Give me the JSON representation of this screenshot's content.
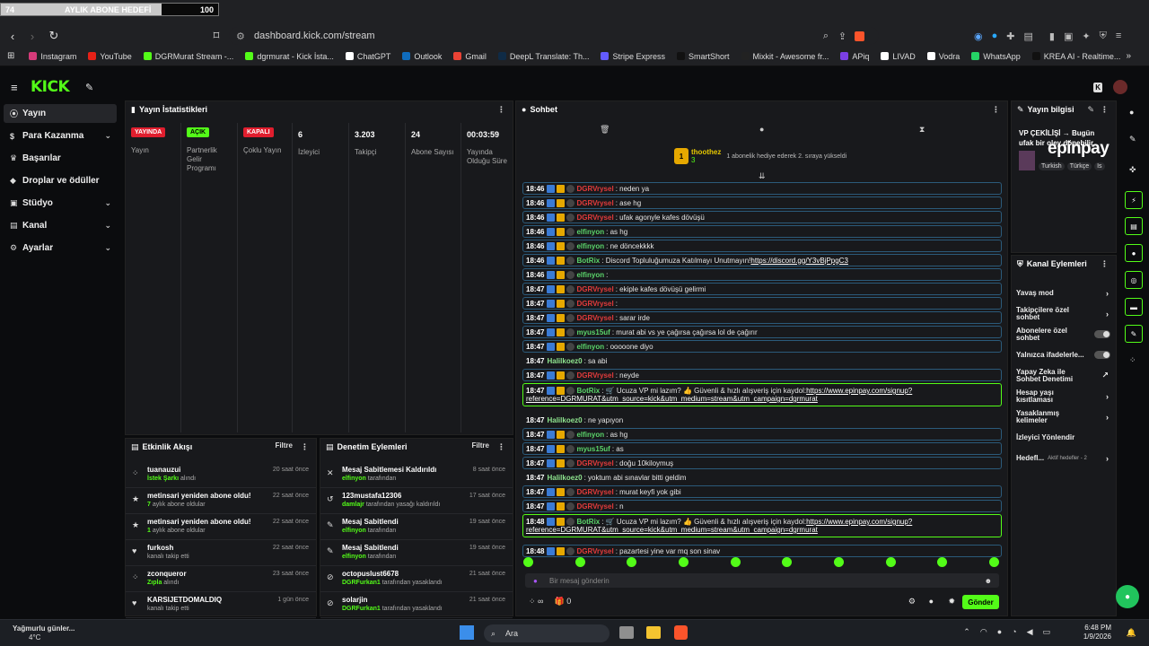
{
  "goal": {
    "current": "74",
    "label": "AYLIK ABONE HEDEFİ",
    "target": "100",
    "progress": 0.74
  },
  "browser": {
    "url": "dashboard.kick.com/stream",
    "bookmarks": [
      {
        "label": "Instagram",
        "color": "#d63b7a"
      },
      {
        "label": "YouTube",
        "color": "#e62117"
      },
      {
        "label": "DGRMurat Stream -...",
        "color": "#53fc18"
      },
      {
        "label": "dgrmurat - Kick İsta...",
        "color": "#53fc18"
      },
      {
        "label": "ChatGPT",
        "color": "#ffffff"
      },
      {
        "label": "Outlook",
        "color": "#0f6cbd"
      },
      {
        "label": "Gmail",
        "color": "#ea4335"
      },
      {
        "label": "DeepL Translate: Th...",
        "color": "#0f2b46"
      },
      {
        "label": "Stripe Express",
        "color": "#635bff"
      },
      {
        "label": "SmartShort",
        "color": "#111111"
      },
      {
        "label": "Mixkit - Awesome fr...",
        "color": "#222222"
      },
      {
        "label": "APiq",
        "color": "#7b3fe4"
      },
      {
        "label": "LIVAD",
        "color": "#ffffff"
      },
      {
        "label": "Vodra",
        "color": "#ffffff"
      },
      {
        "label": "WhatsApp",
        "color": "#25d366"
      },
      {
        "label": "KREA AI - Realtime...",
        "color": "#111111"
      }
    ]
  },
  "sidebar": {
    "items": [
      {
        "label": "Yayın",
        "icon": "broadcast-icon"
      },
      {
        "label": "Para Kazanma",
        "icon": "dollar-icon"
      },
      {
        "label": "Başarılar",
        "icon": "trophy-icon"
      },
      {
        "label": "Droplar ve ödüller",
        "icon": "gift-icon"
      },
      {
        "label": "Stüdyo",
        "icon": "studio-icon"
      },
      {
        "label": "Kanal",
        "icon": "channel-icon"
      },
      {
        "label": "Ayarlar",
        "icon": "gear-icon"
      }
    ]
  },
  "stats": {
    "title": "Yayın İstatistikleri",
    "columns": [
      {
        "badge": "YAYINDA",
        "label": "Yayın"
      },
      {
        "badge": "AÇIK",
        "label": "Partnerlik Gelir Programı"
      },
      {
        "badge": "KAPALI",
        "label": "Çoklu Yayın"
      },
      {
        "value": "6",
        "label": "İzleyici"
      },
      {
        "value": "3.203",
        "label": "Takipçi"
      },
      {
        "value": "24",
        "label": "Abone Sayısı"
      },
      {
        "value": "00:03:59",
        "label": "Yayında Olduğu Süre"
      }
    ]
  },
  "activity": {
    "title": "Etkinlik Akışı",
    "filter": "Filtre",
    "rows": [
      {
        "t1": "tuanauzui",
        "t2b": "İstek Şarkı",
        "t2": " alındı",
        "time": "20 saat önce"
      },
      {
        "t1": "metinsari yeniden abone oldu!",
        "t2b": "7",
        "t2": " aylık abone oldular",
        "time": "22 saat önce"
      },
      {
        "t1": "metinsari yeniden abone oldu!",
        "t2b": "1",
        "t2": " aylık abone oldular",
        "time": "22 saat önce"
      },
      {
        "t1": "furkosh",
        "t2b": "",
        "t2": "kanalı takip etti",
        "time": "22 saat önce"
      },
      {
        "t1": "zconqueror",
        "t2b": "Zıpla",
        "t2": " alındı",
        "time": "23 saat önce"
      },
      {
        "t1": "KARSIJETDOMALDIQ",
        "t2b": "",
        "t2": "kanalı takip etti",
        "time": "1 gün önce"
      }
    ]
  },
  "moderation": {
    "title": "Denetim Eylemleri",
    "filter": "Filtre",
    "rows": [
      {
        "t1": "Mesaj Sabitlemesi Kaldırıldı",
        "t2b": "elfinyon",
        "t2": " tarafından",
        "time": "8 saat önce"
      },
      {
        "t1": "123mustafa12306",
        "t2b": "damlajr",
        "t2": " tarafından yasağı kaldırıldı",
        "time": "17 saat önce"
      },
      {
        "t1": "Mesaj Sabitlendi",
        "t2b": "elfinyon",
        "t2": " tarafından",
        "time": "19 saat önce"
      },
      {
        "t1": "Mesaj Sabitlendi",
        "t2b": "elfinyon",
        "t2": " tarafından",
        "time": "19 saat önce"
      },
      {
        "t1": "octopuslust6678",
        "t2b": "DGRFurkan1",
        "t2": " tarafından yasaklandı",
        "time": "21 saat önce"
      },
      {
        "t1": "solarjin",
        "t2b": "DGRFurkan1",
        "t2": " tarafından yasaklandı",
        "time": "21 saat önce"
      }
    ]
  },
  "chat": {
    "title": "Sohbet",
    "pinned_user": "thoothez",
    "pinned_count": "3",
    "pinned_text": "1 abonelik hediye ederek 2. sıraya yükseldi",
    "messages": [
      {
        "time": "18:46",
        "user": "DGRVrysel",
        "color": "red",
        "text": ": neden ya"
      },
      {
        "time": "18:46",
        "user": "DGRVrysel",
        "color": "red",
        "text": ": ase hg"
      },
      {
        "time": "18:46",
        "user": "DGRVrysel",
        "color": "red",
        "text": ": ufak agonyle kafes dövüşü"
      },
      {
        "time": "18:46",
        "user": "elfinyon",
        "color": "grn",
        "text": ": as hg"
      },
      {
        "time": "18:46",
        "user": "elfinyon",
        "color": "grn",
        "text": ": ne döncekkkk"
      },
      {
        "time": "18:46",
        "user": "BotRix",
        "color": "grn",
        "text": ": Discord Topluluğumuza Katılmayı Unutmayın! ",
        "link": "https://discord.gg/Y3vBjPpgC3"
      },
      {
        "time": "18:46",
        "user": "elfinyon",
        "color": "grn",
        "text": ":"
      },
      {
        "time": "18:47",
        "user": "DGRVrysel",
        "color": "red",
        "text": ": ekiple kafes dövüşü gelirmi"
      },
      {
        "time": "18:47",
        "user": "DGRVrysel",
        "color": "red",
        "text": ":"
      },
      {
        "time": "18:47",
        "user": "DGRVrysel",
        "color": "red",
        "text": ": sarar irde"
      },
      {
        "time": "18:47",
        "user": "myus15uf",
        "color": "grn",
        "text": ": murat abi vs ye çağırsa çağırsa lol de çağırır"
      },
      {
        "time": "18:47",
        "user": "elfinyon",
        "color": "grn",
        "text": ": ooooone diyo"
      },
      {
        "time": "18:47",
        "user": "Halilkoez0",
        "color": "lgr",
        "text": ": sa abi"
      },
      {
        "time": "18:47",
        "user": "DGRVrysel",
        "color": "red",
        "text": ": neyde"
      },
      {
        "time": "18:47",
        "user": "BotRix",
        "color": "grn",
        "text": ": 🛒 Ucuza VP mi lazım? 👍 Güvenli & hızlı alışveriş için kaydol: ",
        "link": "https://www.epinpay.com/signup?",
        "line2": "reference=DGRMURAT&utm_source=kick&utm_medium=stream&utm_campaign=dgrmurat"
      },
      {
        "time": "18:47",
        "user": "Halilkoez0",
        "color": "lgr",
        "text": ": ne yapıyon"
      },
      {
        "time": "18:47",
        "user": "elfinyon",
        "color": "grn",
        "text": ": as hg"
      },
      {
        "time": "18:47",
        "user": "myus15uf",
        "color": "grn",
        "text": ": as"
      },
      {
        "time": "18:47",
        "user": "DGRVrysel",
        "color": "red",
        "text": ": doğu 10kiloymuş"
      },
      {
        "time": "18:47",
        "user": "Halilkoez0",
        "color": "lgr",
        "text": ": yoktum abi sınavlar bitti geldim"
      },
      {
        "time": "18:47",
        "user": "DGRVrysel",
        "color": "red",
        "text": ": murat keyfi yok gibi"
      },
      {
        "time": "18:47",
        "user": "DGRVrysel",
        "color": "red",
        "text": ": n"
      },
      {
        "time": "18:48",
        "user": "BotRix",
        "color": "grn",
        "text": ": 🛒 Ucuza VP mi lazım? 👍 Güvenli & hızlı alışveriş için kaydol: ",
        "link": "https://www.epinpay.com/signup?",
        "line2": "reference=DGRMURAT&utm_source=kick&utm_medium=stream&utm_campaign=dgrmurat"
      },
      {
        "time": "18:48",
        "user": "DGRVrysel",
        "color": "red",
        "text": ": pazartesi yine var mq son sinav"
      }
    ],
    "input_placeholder": "Bir mesaj gönderin",
    "points": "∞",
    "gift_count": "0",
    "send_label": "Gönder"
  },
  "streaminfo": {
    "title": "Yayın bilgisi",
    "text": "VP ÇEKİLİŞİ → Bugün ufak bir oley dönebilir lepinpay...",
    "tags": [
      "Turkish",
      "Türkçe",
      "Is"
    ],
    "overlay_logo": "epinpay"
  },
  "channelactions": {
    "title": "Kanal Eylemleri",
    "rows": [
      {
        "label": "Yavaş mod",
        "type": "chev"
      },
      {
        "label": "Takipçilere özel sohbet",
        "type": "chev"
      },
      {
        "label": "Abonelere özel sohbet",
        "type": "toggle"
      },
      {
        "label": "Yalnızca ifadelerle...",
        "type": "toggle"
      },
      {
        "label": "Yapay Zeka ile Sohbet Denetimi",
        "type": "ext"
      },
      {
        "label": "Hesap yaşı kısıtlaması",
        "type": "chev"
      },
      {
        "label": "Yasaklanmış kelimeler",
        "type": "chev"
      },
      {
        "label": "İzleyici Yönlendir",
        "type": "none"
      },
      {
        "label": "Hedefl...",
        "extra": "Aktif hedefler - 2",
        "type": "chev"
      }
    ]
  },
  "taskbar": {
    "weather_title": "Yağmurlu günler...",
    "weather_temp": "4°C",
    "search": "Ara",
    "time": "6:48 PM",
    "date": "1/9/2026"
  }
}
